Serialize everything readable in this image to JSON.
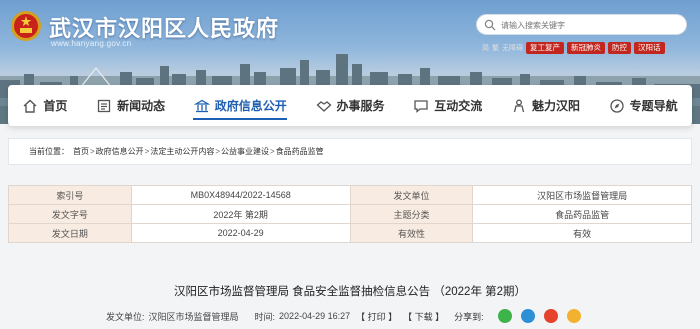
{
  "header": {
    "site_title": "武汉市汉阳区人民政府",
    "site_url": "www.hanyang.gov.cn",
    "search_placeholder": "请输入搜索关键字",
    "quick_links": [
      "简",
      "繁",
      "无障碍"
    ],
    "quick_buttons": [
      "复工复产",
      "新冠肺炎",
      "防控",
      "汉阳话"
    ],
    "colors": {
      "brand_red": "#c2271f",
      "nav_active": "#1f5fb2"
    }
  },
  "nav": {
    "items": [
      {
        "label": "首页",
        "icon": "home-icon"
      },
      {
        "label": "新闻动态",
        "icon": "news-icon"
      },
      {
        "label": "政府信息公开",
        "icon": "building-icon",
        "active": true
      },
      {
        "label": "办事服务",
        "icon": "handshake-icon"
      },
      {
        "label": "互动交流",
        "icon": "chat-icon"
      },
      {
        "label": "魅力汉阳",
        "icon": "person-icon"
      },
      {
        "label": "专题导航",
        "icon": "compass-icon"
      }
    ]
  },
  "breadcrumb": {
    "label": "当前位置：",
    "items": [
      "首页",
      "政府信息公开",
      "法定主动公开内容",
      "公益事业建设",
      "食品药品监管"
    ]
  },
  "meta": {
    "rows": [
      {
        "k1": "索引号",
        "v1": "MB0X48944/2022-14568",
        "k2": "发文单位",
        "v2": "汉阳区市场监督管理局"
      },
      {
        "k1": "发文字号",
        "v1": "2022年 第2期",
        "k2": "主题分类",
        "v2": "食品药品监管"
      },
      {
        "k1": "发文日期",
        "v1": "2022-04-29",
        "k2": "有效性",
        "v2": "有效"
      }
    ]
  },
  "article": {
    "title": "汉阳区市场监督管理局 食品安全监督抽检信息公告 （2022年 第2期）",
    "unit_label": "发文单位:",
    "unit_value": "汉阳区市场监督管理局",
    "time_label": "时间:",
    "time_value": "2022-04-29 16:27",
    "print_label": "【 打印 】",
    "download_label": "【 下载 】",
    "share_label": "分享到:",
    "share_icons": [
      "wechat-icon",
      "qq-icon",
      "weibo-icon",
      "qzone-icon"
    ]
  }
}
